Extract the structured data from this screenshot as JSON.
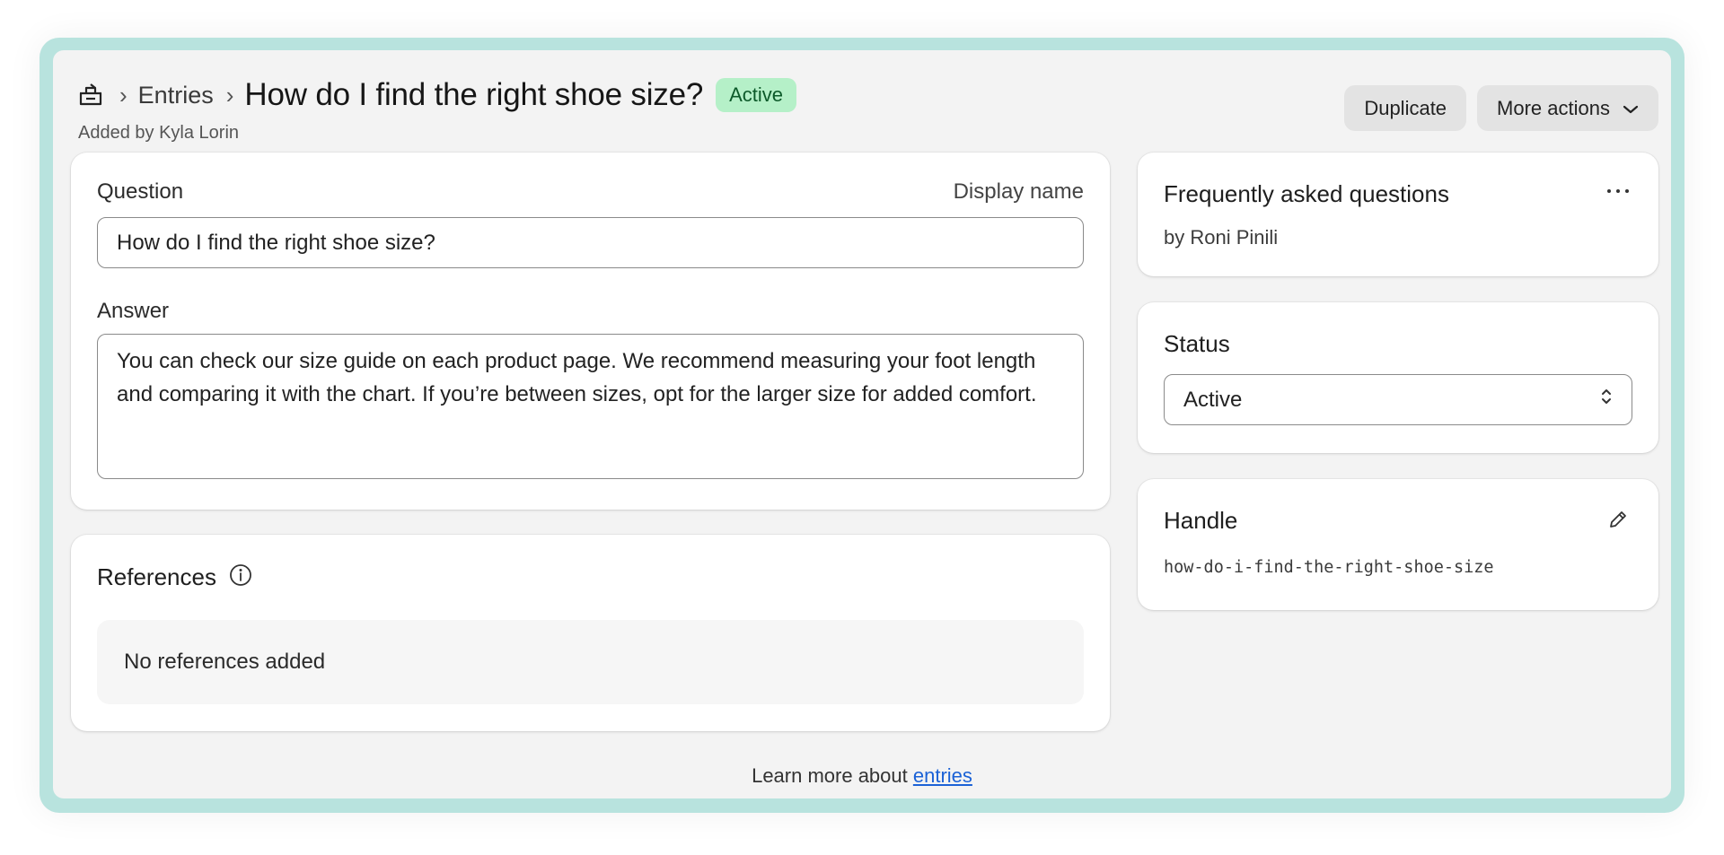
{
  "breadcrumb": {
    "store_icon": "store-icon",
    "parent_label": "Entries",
    "title": "How do I find the right shoe size?",
    "status_badge": "Active",
    "added_by": "Added by Kyla Lorin"
  },
  "toolbar": {
    "duplicate_label": "Duplicate",
    "more_actions_label": "More actions"
  },
  "entry": {
    "question_label": "Question",
    "display_name_hint": "Display name",
    "question_value": "How do I find the right shoe size?",
    "answer_label": "Answer",
    "answer_value": "You can check our size guide on each product page. We recommend measuring your foot length and comparing it with the chart. If you’re between sizes, opt for the larger size for added comfort."
  },
  "references": {
    "title": "References",
    "empty_text": "No references added"
  },
  "faq_card": {
    "title": "Frequently asked questions",
    "author": "by Roni Pinili"
  },
  "status_card": {
    "title": "Status",
    "selected": "Active"
  },
  "handle_card": {
    "title": "Handle",
    "value": "how-do-i-find-the-right-shoe-size"
  },
  "footer": {
    "prefix": "Learn more about ",
    "link_text": "entries"
  },
  "colors": {
    "frame": "#b8e3de",
    "badge_bg": "#b5f0c8",
    "badge_text": "#0d5a2a",
    "link": "#1b62d6"
  }
}
